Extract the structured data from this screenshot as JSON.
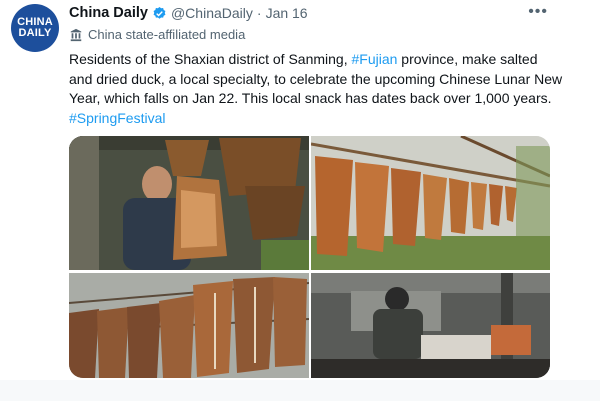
{
  "account": {
    "avatar_line1": "CHINA",
    "avatar_line2": "DAILY",
    "name": "China Daily",
    "handle": "@ChinaDaily",
    "date": "Jan 16",
    "label": "China state-affiliated media"
  },
  "tweet": {
    "text_part1": "Residents of the Shaxian district of Sanming, ",
    "hashtag1": "#Fujian",
    "text_part2": " province, make salted and dried duck, a local specialty, to celebrate the upcoming Chinese Lunar New Year, which falls on Jan 22. This local snack has dates back over 1,000 years. ",
    "hashtag2": "#SpringFestival"
  },
  "icons": {
    "verified": "verified-badge-icon",
    "more": "more-options-icon",
    "label": "government-building-icon"
  },
  "colors": {
    "link": "#1d9bf0",
    "secondary_text": "#536471",
    "avatar_bg": "#1d4f9c"
  }
}
